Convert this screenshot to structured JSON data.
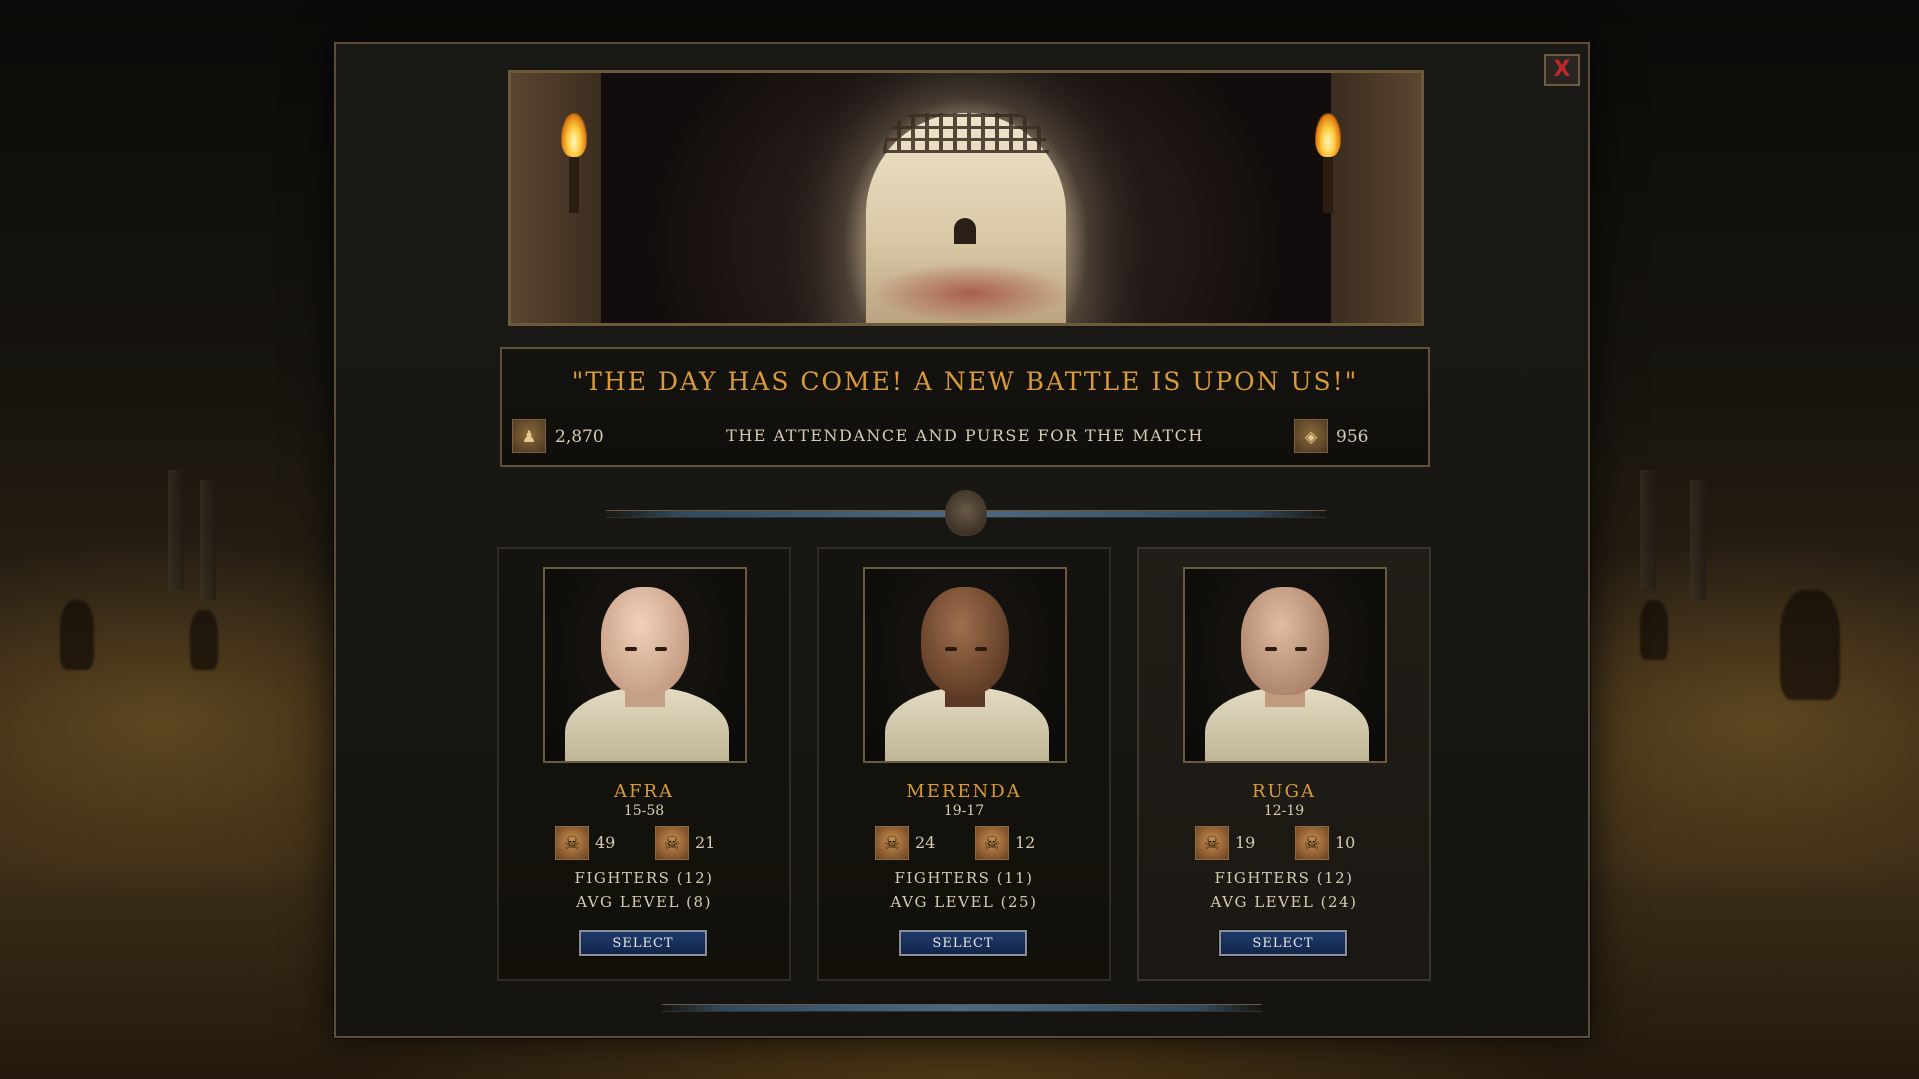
{
  "dialog": {
    "close_label": "X",
    "quote": "\"THE DAY HAS COME! A NEW BATTLE IS UPON US!\"",
    "subtitle": "THE ATTENDANCE AND PURSE FOR THE MATCH",
    "attendance": "2,870",
    "purse": "956",
    "attendance_icon": "crowd-icon",
    "purse_icon": "purse-icon"
  },
  "lanistae": [
    {
      "name": "AFRA",
      "range": "15-58",
      "kills": "49",
      "deaths": "21",
      "fighters": "FIGHTERS (12)",
      "avg_level": "AVG LEVEL (8)",
      "select_label": "SELECT"
    },
    {
      "name": "MERENDA",
      "range": "19-17",
      "kills": "24",
      "deaths": "12",
      "fighters": "FIGHTERS (11)",
      "avg_level": "AVG LEVEL (25)",
      "select_label": "SELECT"
    },
    {
      "name": "RUGA",
      "range": "12-19",
      "kills": "19",
      "deaths": "10",
      "fighters": "FIGHTERS (12)",
      "avg_level": "AVG LEVEL (24)",
      "select_label": "SELECT"
    }
  ],
  "colors": {
    "title_gold": "#d89a3a",
    "text_parchment": "#d8cbb2",
    "button_blue": "#1e3a6a",
    "close_red": "#c0262a"
  }
}
